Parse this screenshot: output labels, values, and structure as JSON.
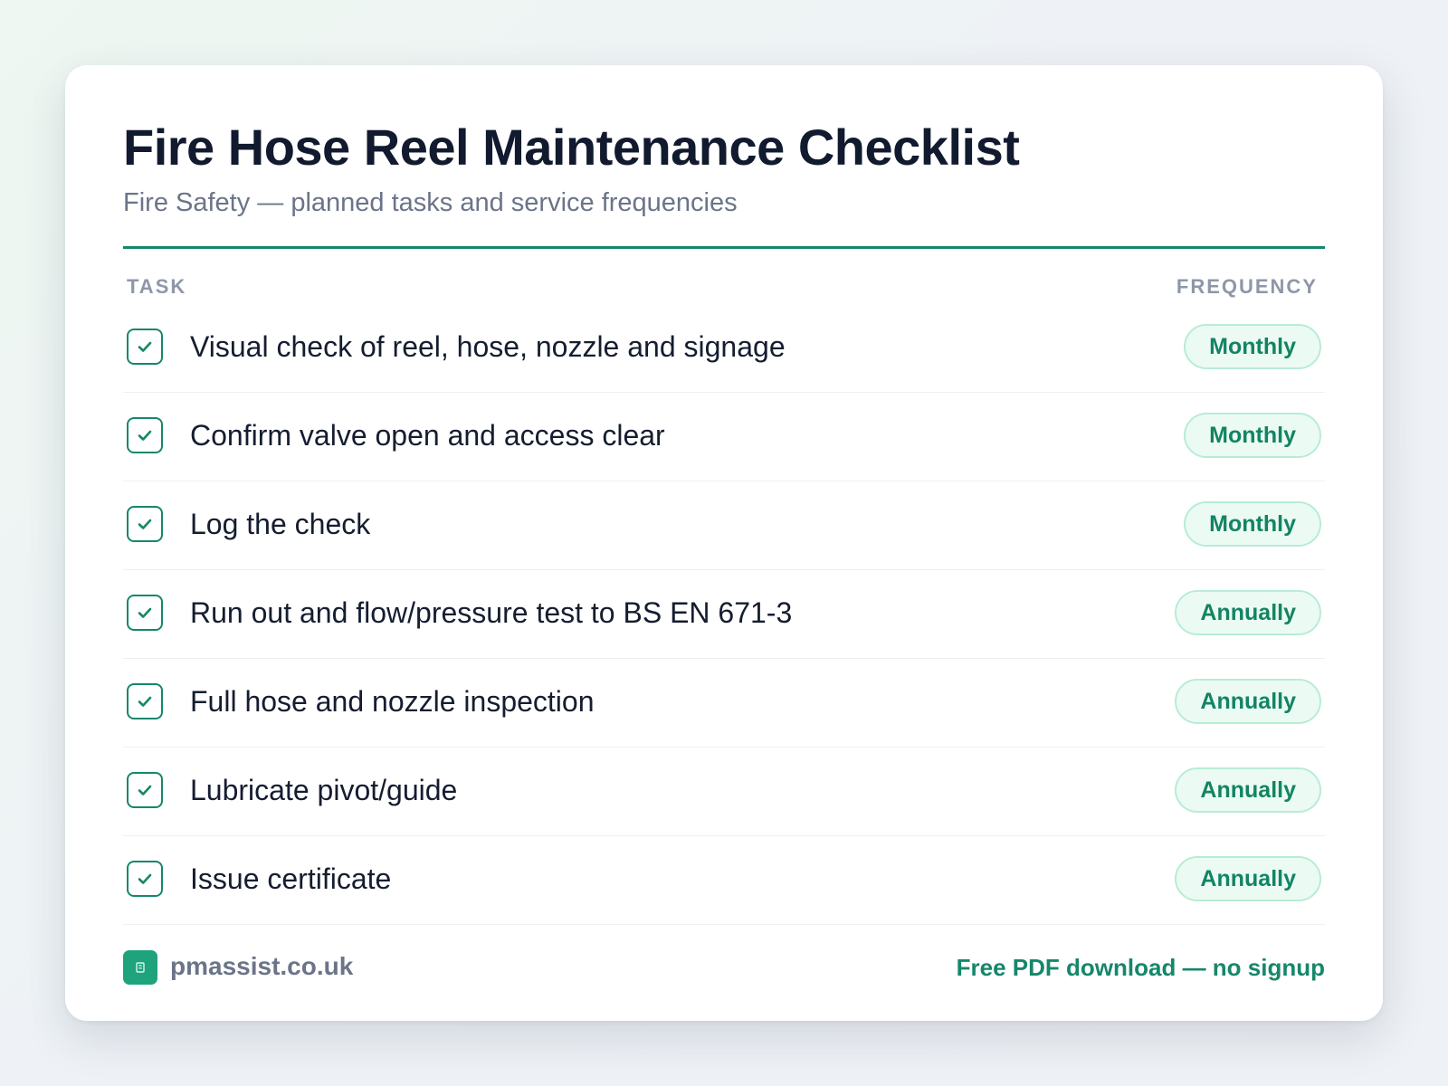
{
  "header": {
    "title": "Fire Hose Reel Maintenance Checklist",
    "subtitle": "Fire Safety — planned tasks and service frequencies"
  },
  "table": {
    "columns": {
      "task": "TASK",
      "frequency": "FREQUENCY"
    },
    "rows": [
      {
        "task": "Visual check of reel, hose, nozzle and signage",
        "frequency": "Monthly",
        "checked": true
      },
      {
        "task": "Confirm valve open and access clear",
        "frequency": "Monthly",
        "checked": true
      },
      {
        "task": "Log the check",
        "frequency": "Monthly",
        "checked": true
      },
      {
        "task": "Run out and flow/pressure test to BS EN 671-3",
        "frequency": "Annually",
        "checked": true
      },
      {
        "task": "Full hose and nozzle inspection",
        "frequency": "Annually",
        "checked": true
      },
      {
        "task": "Lubricate pivot/guide",
        "frequency": "Annually",
        "checked": true
      },
      {
        "task": "Issue certificate",
        "frequency": "Annually",
        "checked": true
      }
    ]
  },
  "footer": {
    "site": "pmassist.co.uk",
    "logo_icon": "building-icon",
    "cta": "Free PDF download — no signup"
  },
  "colors": {
    "accent": "#16876a",
    "badge_bg": "#ebfbf3",
    "badge_border": "#b8ecd5",
    "title": "#111a2e",
    "muted": "#6b7488"
  }
}
